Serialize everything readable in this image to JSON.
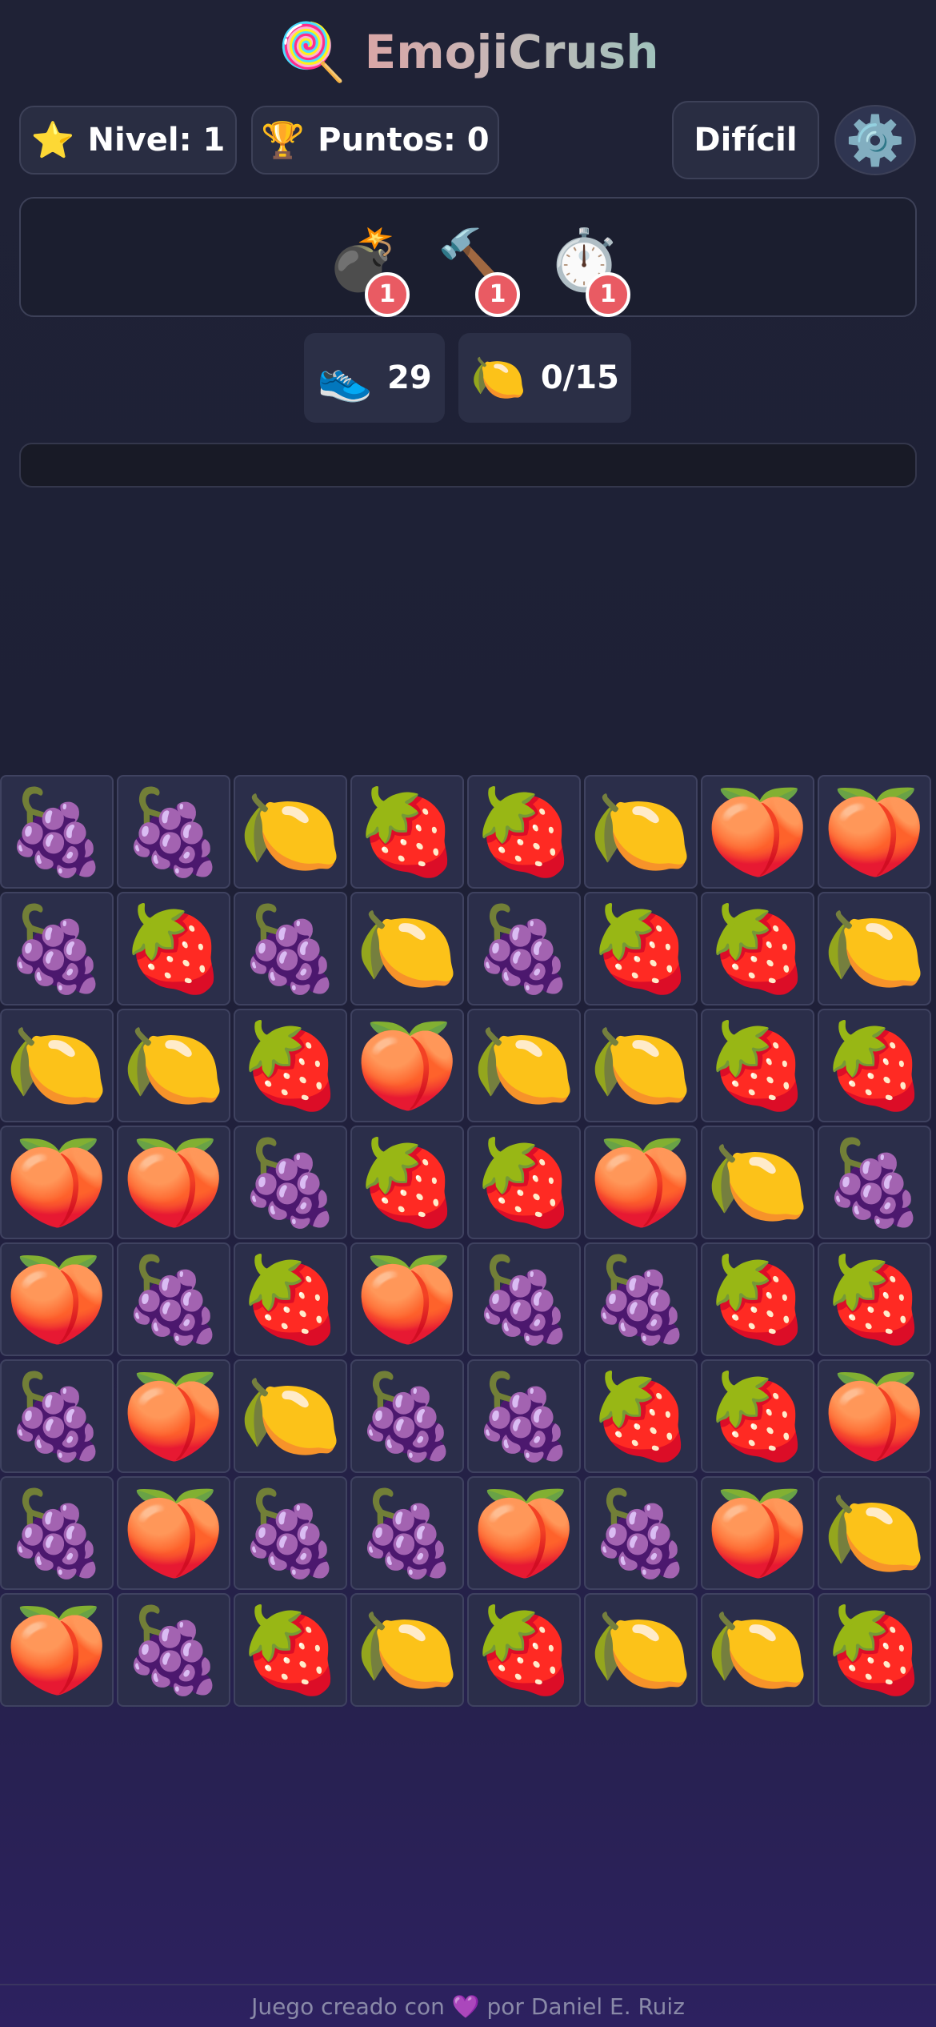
{
  "app": {
    "title": "EmojiCrush",
    "title_icon": "🍭"
  },
  "header": {
    "level": {
      "icon": "⭐",
      "label": "Nivel: 1"
    },
    "points": {
      "icon": "🏆",
      "label": "Puntos: 0"
    },
    "difficulty": "Difícil",
    "settings_icon": "⚙️"
  },
  "powerups": [
    {
      "name": "bomb",
      "icon": "💣",
      "count": "1"
    },
    {
      "name": "hammer",
      "icon": "🔨",
      "count": "1"
    },
    {
      "name": "stopwatch",
      "icon": "⏱️",
      "count": "1"
    }
  ],
  "stats": {
    "moves": {
      "icon": "👟",
      "value": "29"
    },
    "goal": {
      "icon": "🍋",
      "value": "0/15"
    }
  },
  "progress": {
    "fraction": 0
  },
  "board": {
    "rows": [
      [
        "🍇",
        "🍇",
        "🍋",
        "🍓",
        "🍓",
        "🍋",
        "🍑",
        "🍑"
      ],
      [
        "🍇",
        "🍓",
        "🍇",
        "🍋",
        "🍇",
        "🍓",
        "🍓",
        "🍋"
      ],
      [
        "🍋",
        "🍋",
        "🍓",
        "🍑",
        "🍋",
        "🍋",
        "🍓",
        "🍓"
      ],
      [
        "🍑",
        "🍑",
        "🍇",
        "🍓",
        "🍓",
        "🍑",
        "🍋",
        "🍇"
      ],
      [
        "🍑",
        "🍇",
        "🍓",
        "🍑",
        "🍇",
        "🍇",
        "🍓",
        "🍓"
      ],
      [
        "🍇",
        "🍑",
        "🍋",
        "🍇",
        "🍇",
        "🍓",
        "🍓",
        "🍑"
      ],
      [
        "🍇",
        "🍑",
        "🍇",
        "🍇",
        "🍑",
        "🍇",
        "🍑",
        "🍋"
      ],
      [
        "🍑",
        "🍇",
        "🍓",
        "🍋",
        "🍓",
        "🍋",
        "🍋",
        "🍓"
      ]
    ]
  },
  "footer": {
    "text": "Juego creado con 💜 por Daniel E. Ruiz"
  },
  "colors": {
    "tile_bg": "#2b2e4a",
    "badge": "#e95b63",
    "pill_bg": "#292d42"
  }
}
